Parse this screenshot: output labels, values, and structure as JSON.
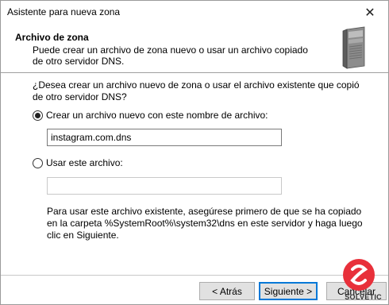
{
  "window": {
    "title": "Asistente para nueva zona"
  },
  "header": {
    "title": "Archivo de zona",
    "subtitle": "Puede crear un archivo de zona nuevo o usar un archivo copiado de otro servidor DNS."
  },
  "body": {
    "question": "¿Desea crear un archivo nuevo de zona o usar el archivo existente que copió de otro servidor DNS?",
    "option_new": {
      "label": "Crear un archivo nuevo con este nombre de archivo:",
      "checked": true
    },
    "new_file_value": "instagram.com.dns",
    "option_existing": {
      "label": "Usar este archivo:",
      "checked": false
    },
    "existing_file_value": "",
    "note": "Para usar este archivo existente, asegúrese primero de que se ha copiado en la carpeta %SystemRoot%\\system32\\dns en este servidor y haga luego clic en Siguiente."
  },
  "footer": {
    "back_label": "< Atrás",
    "next_label": "Siguiente >",
    "cancel_label": "Cancelar"
  },
  "watermark": {
    "text": "SOLVETIC",
    "color": "#e8303a"
  },
  "colors": {
    "accent": "#0078d7"
  }
}
